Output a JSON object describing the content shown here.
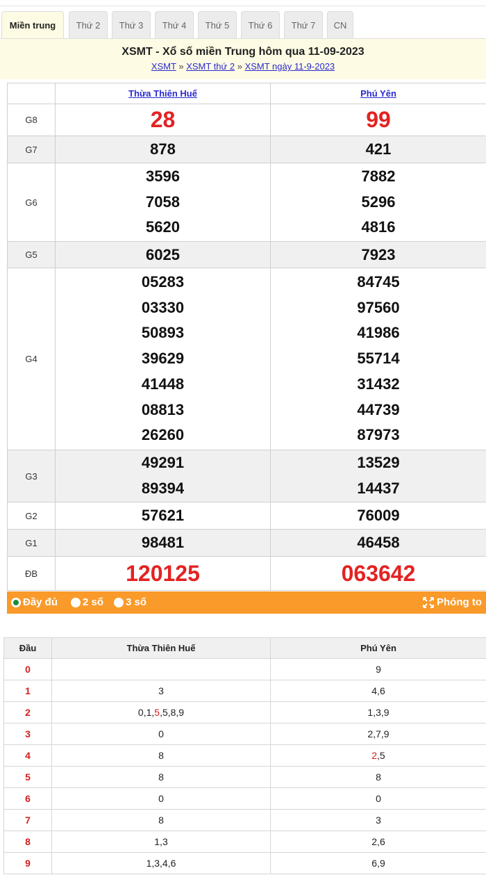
{
  "tabs": [
    "Miền trung",
    "Thứ 2",
    "Thứ 3",
    "Thứ 4",
    "Thứ 5",
    "Thứ 6",
    "Thứ 7",
    "CN"
  ],
  "header": {
    "title": "XSMT - Xổ số miền Trung hôm qua 11-09-2023",
    "crumb1": "XSMT",
    "crumb2": "XSMT thứ 2",
    "crumb3": "XSMT ngày 11-9-2023",
    "sep": "»"
  },
  "results": {
    "provinces": [
      "Thừa Thiên Huế",
      "Phú Yên"
    ],
    "prizes": [
      {
        "label": "G8",
        "a": [
          "28"
        ],
        "b": [
          "99"
        ]
      },
      {
        "label": "G7",
        "a": [
          "878"
        ],
        "b": [
          "421"
        ]
      },
      {
        "label": "G6",
        "a": [
          "3596",
          "7058",
          "5620"
        ],
        "b": [
          "7882",
          "5296",
          "4816"
        ]
      },
      {
        "label": "G5",
        "a": [
          "6025"
        ],
        "b": [
          "7923"
        ]
      },
      {
        "label": "G4",
        "a": [
          "05283",
          "03330",
          "50893",
          "39629",
          "41448",
          "08813",
          "26260"
        ],
        "b": [
          "84745",
          "97560",
          "41986",
          "55714",
          "31432",
          "44739",
          "87973"
        ]
      },
      {
        "label": "G3",
        "a": [
          "49291",
          "89394"
        ],
        "b": [
          "13529",
          "14437"
        ]
      },
      {
        "label": "G2",
        "a": [
          "57621"
        ],
        "b": [
          "76009"
        ]
      },
      {
        "label": "G1",
        "a": [
          "98481"
        ],
        "b": [
          "46458"
        ]
      },
      {
        "label": "ĐB",
        "a": [
          "120125"
        ],
        "b": [
          "063642"
        ]
      }
    ]
  },
  "options": {
    "full": "Đầy đủ",
    "two": "2 số",
    "three": "3 số",
    "zoom": "Phóng to"
  },
  "loto": {
    "headers": [
      "Đầu",
      "Thừa Thiên Huế",
      "Phú Yên"
    ],
    "rows": [
      {
        "dau": "0",
        "a": "",
        "b": "9"
      },
      {
        "dau": "1",
        "a": "3",
        "b": "4,6"
      },
      {
        "dau": "2",
        "a_pre": "0,1,",
        "a_red": "5",
        "a_post": ",5,8,9",
        "b": "1,3,9"
      },
      {
        "dau": "3",
        "a": "0",
        "b": "2,7,9"
      },
      {
        "dau": "4",
        "a": "8",
        "b_red": "2",
        "b_post": ",5"
      },
      {
        "dau": "5",
        "a": "8",
        "b": "8"
      },
      {
        "dau": "6",
        "a": "0",
        "b": "0"
      },
      {
        "dau": "7",
        "a": "8",
        "b": "3"
      },
      {
        "dau": "8",
        "a": "1,3",
        "b": "2,6"
      },
      {
        "dau": "9",
        "a": "1,3,4,6",
        "b": "6,9"
      }
    ]
  },
  "colors": {
    "accent": "#f99a2a",
    "highlight": "#e32222",
    "link": "#2a2ad0",
    "header_bg": "#fdfbe3"
  }
}
